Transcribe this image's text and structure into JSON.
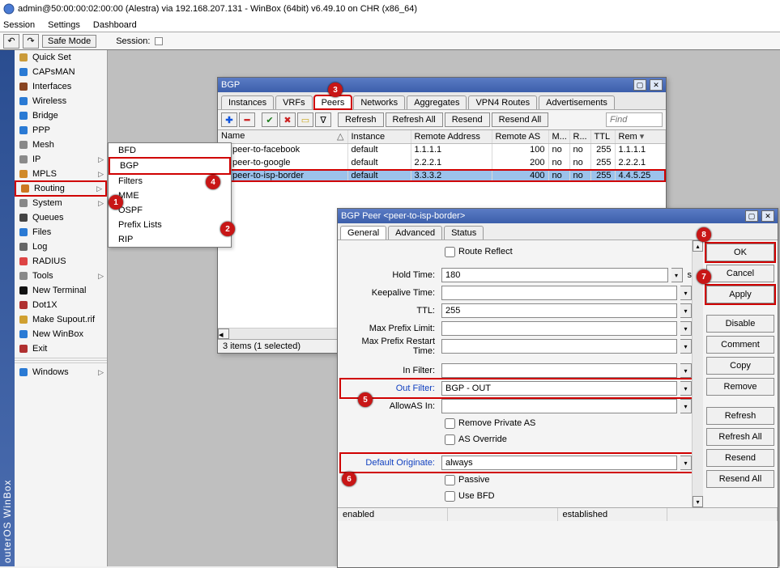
{
  "window": {
    "title": "admin@50:00:00:02:00:00 (Alestra) via 192.168.207.131 - WinBox (64bit) v6.49.10 on CHR (x86_64)"
  },
  "menubar": [
    "Session",
    "Settings",
    "Dashboard"
  ],
  "toolbar": {
    "safe_mode": "Safe Mode",
    "session_lbl": "Session:"
  },
  "leftstrip": "outerOS WinBox",
  "sidebar": {
    "items": [
      {
        "label": "Quick Set",
        "caret": false
      },
      {
        "label": "CAPsMAN",
        "caret": false
      },
      {
        "label": "Interfaces",
        "caret": false
      },
      {
        "label": "Wireless",
        "caret": false
      },
      {
        "label": "Bridge",
        "caret": false
      },
      {
        "label": "PPP",
        "caret": false
      },
      {
        "label": "Mesh",
        "caret": false
      },
      {
        "label": "IP",
        "caret": true
      },
      {
        "label": "MPLS",
        "caret": true
      },
      {
        "label": "Routing",
        "caret": true,
        "selected": true
      },
      {
        "label": "System",
        "caret": true
      },
      {
        "label": "Queues",
        "caret": false
      },
      {
        "label": "Files",
        "caret": false
      },
      {
        "label": "Log",
        "caret": false
      },
      {
        "label": "RADIUS",
        "caret": false
      },
      {
        "label": "Tools",
        "caret": true
      },
      {
        "label": "New Terminal",
        "caret": false
      },
      {
        "label": "Dot1X",
        "caret": false
      },
      {
        "label": "Make Supout.rif",
        "caret": false
      },
      {
        "label": "New WinBox",
        "caret": false
      },
      {
        "label": "Exit",
        "caret": false
      },
      {
        "label": "Windows",
        "caret": true
      }
    ]
  },
  "submenu": {
    "items": [
      "BFD",
      "BGP",
      "Filters",
      "MME",
      "OSPF",
      "Prefix Lists",
      "RIP"
    ],
    "selected": 1
  },
  "bgp_window": {
    "title": "BGP",
    "tabs": [
      "Instances",
      "VRFs",
      "Peers",
      "Networks",
      "Aggregates",
      "VPN4 Routes",
      "Advertisements"
    ],
    "active_tab": 2,
    "tools": {
      "refresh": "Refresh",
      "refresh_all": "Refresh All",
      "resend": "Resend",
      "resend_all": "Resend All",
      "find": "Find"
    },
    "columns": [
      "Name",
      "Instance",
      "Remote Address",
      "Remote AS",
      "M...",
      "R...",
      "TTL",
      "Rem"
    ],
    "rows": [
      {
        "name": "peer-to-facebook",
        "instance": "default",
        "raddr": "1.1.1.1",
        "ras": "100",
        "m": "no",
        "r": "no",
        "ttl": "255",
        "rem": "1.1.1.1"
      },
      {
        "name": "peer-to-google",
        "instance": "default",
        "raddr": "2.2.2.1",
        "ras": "200",
        "m": "no",
        "r": "no",
        "ttl": "255",
        "rem": "2.2.2.1"
      },
      {
        "name": "peer-to-isp-border",
        "instance": "default",
        "raddr": "3.3.3.2",
        "ras": "400",
        "m": "no",
        "r": "no",
        "ttl": "255",
        "rem": "4.4.5.25"
      }
    ],
    "sel_row": 2,
    "status": "3 items (1 selected)"
  },
  "peer_window": {
    "title": "BGP Peer <peer-to-isp-border>",
    "tabs": [
      "General",
      "Advanced",
      "Status"
    ],
    "active_tab": 0,
    "fields": {
      "route_reflect": "Route Reflect",
      "hold_time_lbl": "Hold Time:",
      "hold_time": "180",
      "hold_unit": "s",
      "keepalive_lbl": "Keepalive Time:",
      "keepalive": "",
      "ttl_lbl": "TTL:",
      "ttl": "255",
      "max_prefix_lbl": "Max Prefix Limit:",
      "max_prefix": "",
      "max_prefix_restart_lbl": "Max Prefix Restart Time:",
      "max_prefix_restart": "",
      "in_filter_lbl": "In Filter:",
      "in_filter": "",
      "out_filter_lbl": "Out Filter:",
      "out_filter": "BGP - OUT",
      "allowas_lbl": "AllowAS In:",
      "allowas": "",
      "remove_private_as": "Remove Private AS",
      "as_override": "AS Override",
      "default_originate_lbl": "Default Originate:",
      "default_originate": "always",
      "passive": "Passive",
      "use_bfd": "Use BFD"
    },
    "buttons": [
      "OK",
      "Cancel",
      "Apply",
      "Disable",
      "Comment",
      "Copy",
      "Remove",
      "Refresh",
      "Refresh All",
      "Resend",
      "Resend All"
    ],
    "status_left": "enabled",
    "status_right": "established"
  },
  "markers": {
    "1": "1",
    "2": "2",
    "3": "3",
    "4": "4",
    "5": "5",
    "6": "6",
    "7": "7",
    "8": "8"
  }
}
